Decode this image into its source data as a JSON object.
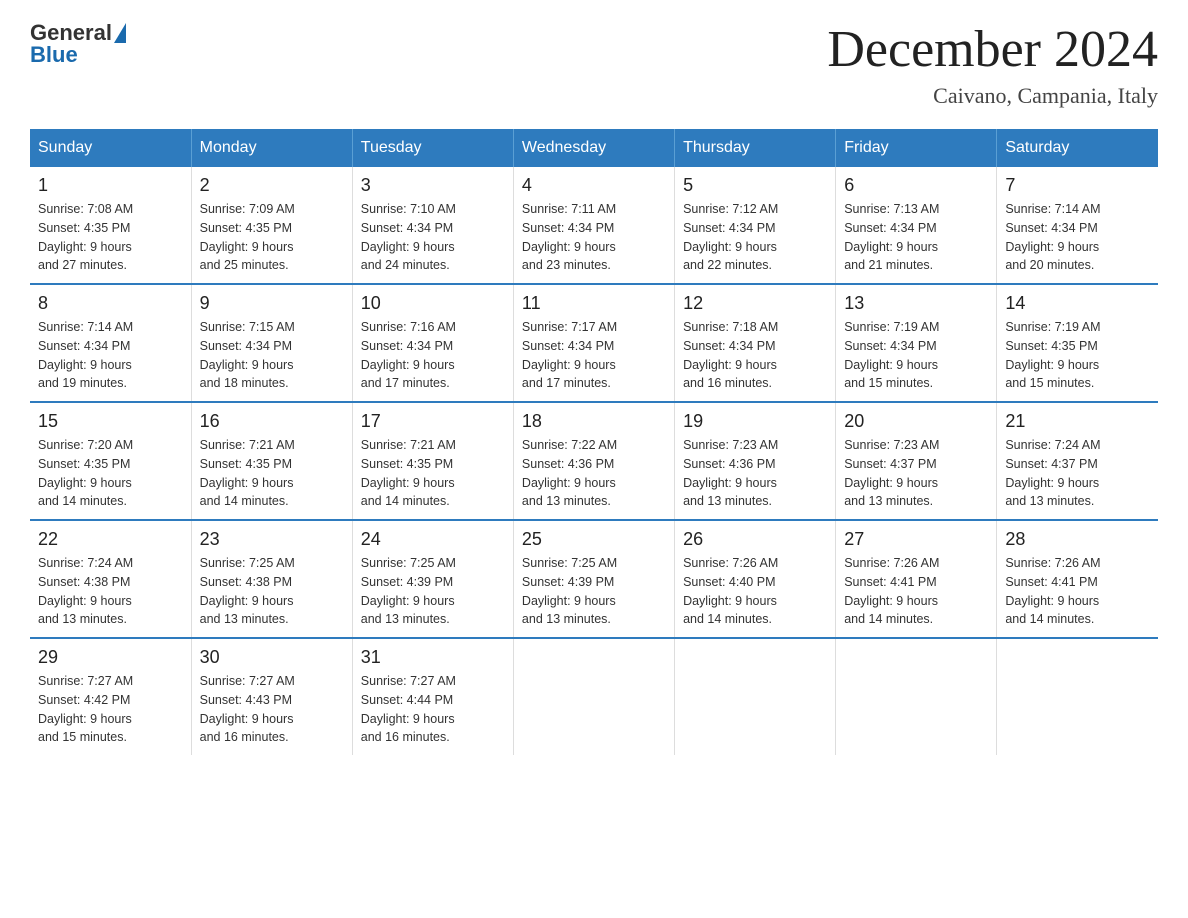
{
  "header": {
    "logo": {
      "general": "General",
      "blue": "Blue"
    },
    "title": "December 2024",
    "location": "Caivano, Campania, Italy"
  },
  "days_of_week": [
    "Sunday",
    "Monday",
    "Tuesday",
    "Wednesday",
    "Thursday",
    "Friday",
    "Saturday"
  ],
  "weeks": [
    [
      {
        "day": "1",
        "sunrise": "7:08 AM",
        "sunset": "4:35 PM",
        "daylight": "9 hours and 27 minutes."
      },
      {
        "day": "2",
        "sunrise": "7:09 AM",
        "sunset": "4:35 PM",
        "daylight": "9 hours and 25 minutes."
      },
      {
        "day": "3",
        "sunrise": "7:10 AM",
        "sunset": "4:34 PM",
        "daylight": "9 hours and 24 minutes."
      },
      {
        "day": "4",
        "sunrise": "7:11 AM",
        "sunset": "4:34 PM",
        "daylight": "9 hours and 23 minutes."
      },
      {
        "day": "5",
        "sunrise": "7:12 AM",
        "sunset": "4:34 PM",
        "daylight": "9 hours and 22 minutes."
      },
      {
        "day": "6",
        "sunrise": "7:13 AM",
        "sunset": "4:34 PM",
        "daylight": "9 hours and 21 minutes."
      },
      {
        "day": "7",
        "sunrise": "7:14 AM",
        "sunset": "4:34 PM",
        "daylight": "9 hours and 20 minutes."
      }
    ],
    [
      {
        "day": "8",
        "sunrise": "7:14 AM",
        "sunset": "4:34 PM",
        "daylight": "9 hours and 19 minutes."
      },
      {
        "day": "9",
        "sunrise": "7:15 AM",
        "sunset": "4:34 PM",
        "daylight": "9 hours and 18 minutes."
      },
      {
        "day": "10",
        "sunrise": "7:16 AM",
        "sunset": "4:34 PM",
        "daylight": "9 hours and 17 minutes."
      },
      {
        "day": "11",
        "sunrise": "7:17 AM",
        "sunset": "4:34 PM",
        "daylight": "9 hours and 17 minutes."
      },
      {
        "day": "12",
        "sunrise": "7:18 AM",
        "sunset": "4:34 PM",
        "daylight": "9 hours and 16 minutes."
      },
      {
        "day": "13",
        "sunrise": "7:19 AM",
        "sunset": "4:34 PM",
        "daylight": "9 hours and 15 minutes."
      },
      {
        "day": "14",
        "sunrise": "7:19 AM",
        "sunset": "4:35 PM",
        "daylight": "9 hours and 15 minutes."
      }
    ],
    [
      {
        "day": "15",
        "sunrise": "7:20 AM",
        "sunset": "4:35 PM",
        "daylight": "9 hours and 14 minutes."
      },
      {
        "day": "16",
        "sunrise": "7:21 AM",
        "sunset": "4:35 PM",
        "daylight": "9 hours and 14 minutes."
      },
      {
        "day": "17",
        "sunrise": "7:21 AM",
        "sunset": "4:35 PM",
        "daylight": "9 hours and 14 minutes."
      },
      {
        "day": "18",
        "sunrise": "7:22 AM",
        "sunset": "4:36 PM",
        "daylight": "9 hours and 13 minutes."
      },
      {
        "day": "19",
        "sunrise": "7:23 AM",
        "sunset": "4:36 PM",
        "daylight": "9 hours and 13 minutes."
      },
      {
        "day": "20",
        "sunrise": "7:23 AM",
        "sunset": "4:37 PM",
        "daylight": "9 hours and 13 minutes."
      },
      {
        "day": "21",
        "sunrise": "7:24 AM",
        "sunset": "4:37 PM",
        "daylight": "9 hours and 13 minutes."
      }
    ],
    [
      {
        "day": "22",
        "sunrise": "7:24 AM",
        "sunset": "4:38 PM",
        "daylight": "9 hours and 13 minutes."
      },
      {
        "day": "23",
        "sunrise": "7:25 AM",
        "sunset": "4:38 PM",
        "daylight": "9 hours and 13 minutes."
      },
      {
        "day": "24",
        "sunrise": "7:25 AM",
        "sunset": "4:39 PM",
        "daylight": "9 hours and 13 minutes."
      },
      {
        "day": "25",
        "sunrise": "7:25 AM",
        "sunset": "4:39 PM",
        "daylight": "9 hours and 13 minutes."
      },
      {
        "day": "26",
        "sunrise": "7:26 AM",
        "sunset": "4:40 PM",
        "daylight": "9 hours and 14 minutes."
      },
      {
        "day": "27",
        "sunrise": "7:26 AM",
        "sunset": "4:41 PM",
        "daylight": "9 hours and 14 minutes."
      },
      {
        "day": "28",
        "sunrise": "7:26 AM",
        "sunset": "4:41 PM",
        "daylight": "9 hours and 14 minutes."
      }
    ],
    [
      {
        "day": "29",
        "sunrise": "7:27 AM",
        "sunset": "4:42 PM",
        "daylight": "9 hours and 15 minutes."
      },
      {
        "day": "30",
        "sunrise": "7:27 AM",
        "sunset": "4:43 PM",
        "daylight": "9 hours and 16 minutes."
      },
      {
        "day": "31",
        "sunrise": "7:27 AM",
        "sunset": "4:44 PM",
        "daylight": "9 hours and 16 minutes."
      },
      {
        "day": "",
        "sunrise": "",
        "sunset": "",
        "daylight": ""
      },
      {
        "day": "",
        "sunrise": "",
        "sunset": "",
        "daylight": ""
      },
      {
        "day": "",
        "sunrise": "",
        "sunset": "",
        "daylight": ""
      },
      {
        "day": "",
        "sunrise": "",
        "sunset": "",
        "daylight": ""
      }
    ]
  ],
  "labels": {
    "sunrise": "Sunrise:",
    "sunset": "Sunset:",
    "daylight": "Daylight:"
  }
}
